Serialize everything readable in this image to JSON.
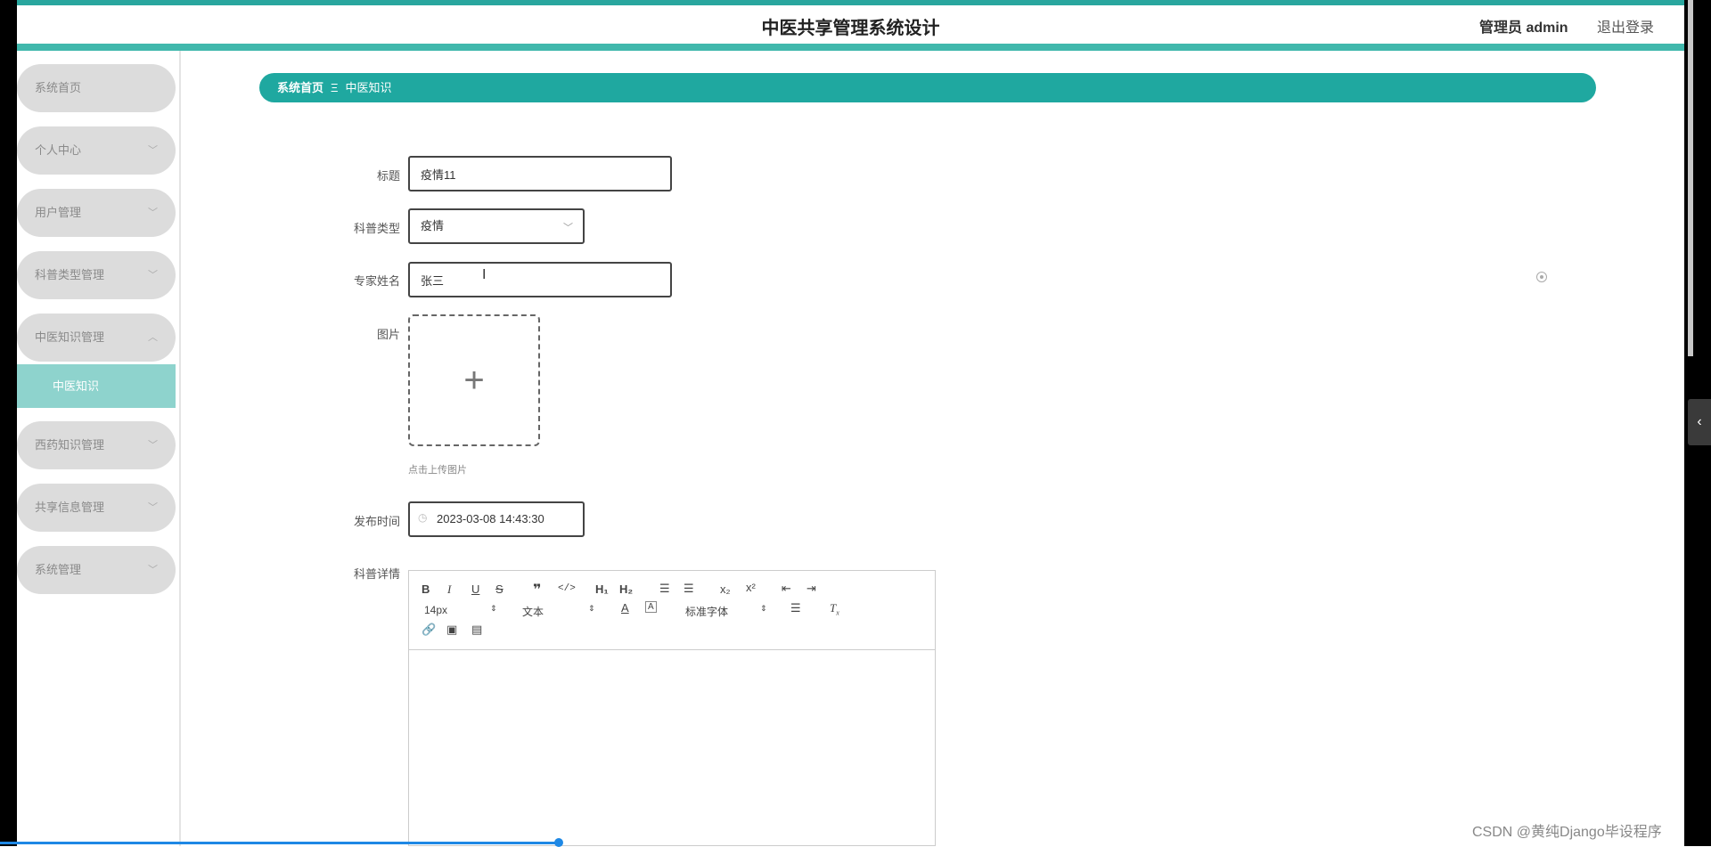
{
  "header": {
    "title": "中医共享管理系统设计",
    "admin": "管理员 admin",
    "logout": "退出登录"
  },
  "sidebar": {
    "items": [
      {
        "label": "系统首页",
        "chevron": ""
      },
      {
        "label": "个人中心",
        "chevron": "﹀"
      },
      {
        "label": "用户管理",
        "chevron": "﹀"
      },
      {
        "label": "科普类型管理",
        "chevron": "﹀"
      },
      {
        "label": "中医知识管理",
        "chevron": "︿"
      },
      {
        "label": "西药知识管理",
        "chevron": "﹀"
      },
      {
        "label": "共享信息管理",
        "chevron": "﹀"
      },
      {
        "label": "系统管理",
        "chevron": "﹀"
      }
    ],
    "sub_item": "中医知识"
  },
  "breadcrumb": {
    "home": "系统首页",
    "sep": "Ξ",
    "current": "中医知识"
  },
  "form": {
    "title_label": "标题",
    "title_value": "疫情11",
    "type_label": "科普类型",
    "type_value": "疫情",
    "expert_label": "专家姓名",
    "expert_value": "张三",
    "image_label": "图片",
    "image_hint": "点击上传图片",
    "time_label": "发布时间",
    "time_value": "2023-03-08 14:43:30",
    "detail_label": "科普详情"
  },
  "editor_toolbar": {
    "font_size": "14px",
    "header_select": "文本",
    "font_family": "标准字体"
  },
  "watermark": "CSDN @黄纯Django毕设程序",
  "colors": {
    "accent": "#1fa8a0",
    "sub_active": "#8ed3cd",
    "menu_bg": "#dcdcdc"
  }
}
